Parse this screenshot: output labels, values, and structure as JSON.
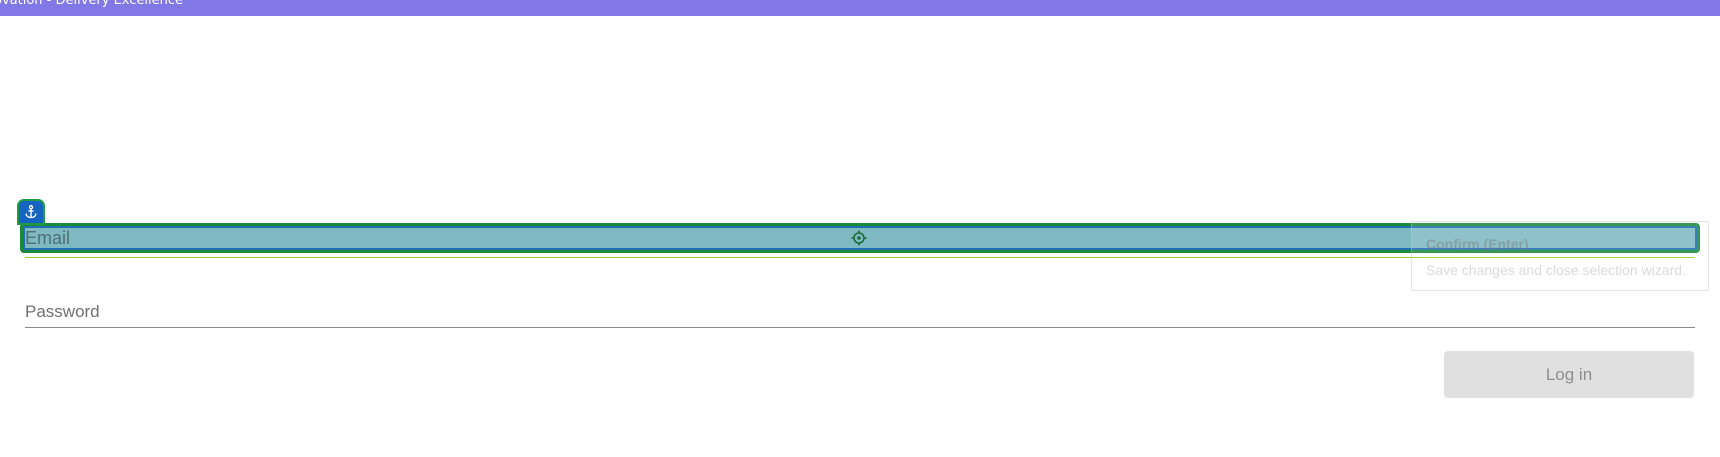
{
  "header": {
    "title": "ovation - Delivery Excellence",
    "color": "#8277e6"
  },
  "form": {
    "email_label": "Email",
    "password_label": "Password",
    "login_label": "Log in"
  },
  "tooltip": {
    "title": "Confirm (Enter)",
    "body": "Save changes and close selection wizard."
  },
  "icons": {
    "anchor": "anchor-icon",
    "target": "crosshair-icon"
  },
  "colors": {
    "selection_fill": "#7fb9c2",
    "selection_border": "#1b8a3a",
    "accent_blue": "#1565c0"
  }
}
